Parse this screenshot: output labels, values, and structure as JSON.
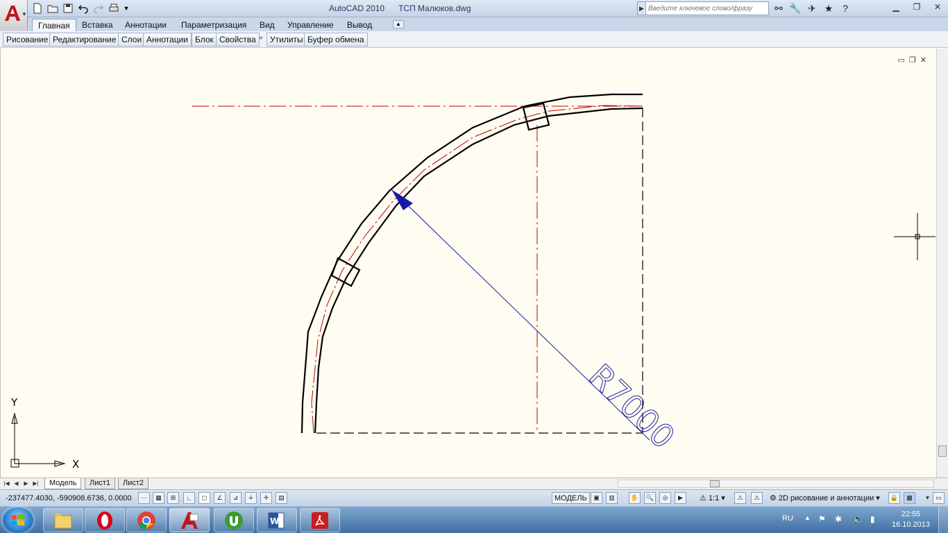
{
  "window": {
    "app_name": "AutoCAD 2010",
    "file_name": "ТСП Малюков.dwg",
    "search_placeholder": "Введите ключевое слово/фразу"
  },
  "quick_access": [
    "new-icon",
    "open-icon",
    "save-icon",
    "undo-icon",
    "redo-icon",
    "plot-icon",
    "dropdown-icon"
  ],
  "menu": {
    "tabs": [
      {
        "label": "Главная",
        "active": true
      },
      {
        "label": "Вставка"
      },
      {
        "label": "Аннотации"
      },
      {
        "label": "Параметризация"
      },
      {
        "label": "Вид"
      },
      {
        "label": "Управление"
      },
      {
        "label": "Вывод"
      }
    ]
  },
  "ribbon": {
    "panels": [
      "Рисование",
      "Редактирование",
      "Слои",
      "Аннотации",
      "Блок",
      "Свойства",
      "Утилиты",
      "Буфер обмена"
    ]
  },
  "drawing": {
    "dimension_text": "R7000",
    "ucs_x": "X",
    "ucs_y": "Y"
  },
  "layout": {
    "tabs": [
      {
        "label": "Модель",
        "active": true
      },
      {
        "label": "Лист1"
      },
      {
        "label": "Лист2"
      }
    ]
  },
  "status": {
    "coordinates": "-237477.4030, -590908.6736, 0.0000",
    "model_label": "МОДЕЛЬ",
    "scale": "1:1",
    "workspace": "2D рисование и аннотации"
  },
  "taskbar": {
    "apps": [
      "explorer-icon",
      "opera-icon",
      "chrome-icon",
      "autocad-icon",
      "utorrent-icon",
      "word-icon",
      "acrobat-icon"
    ],
    "lang": "RU",
    "time": "22:55",
    "date": "16.10.2013"
  }
}
